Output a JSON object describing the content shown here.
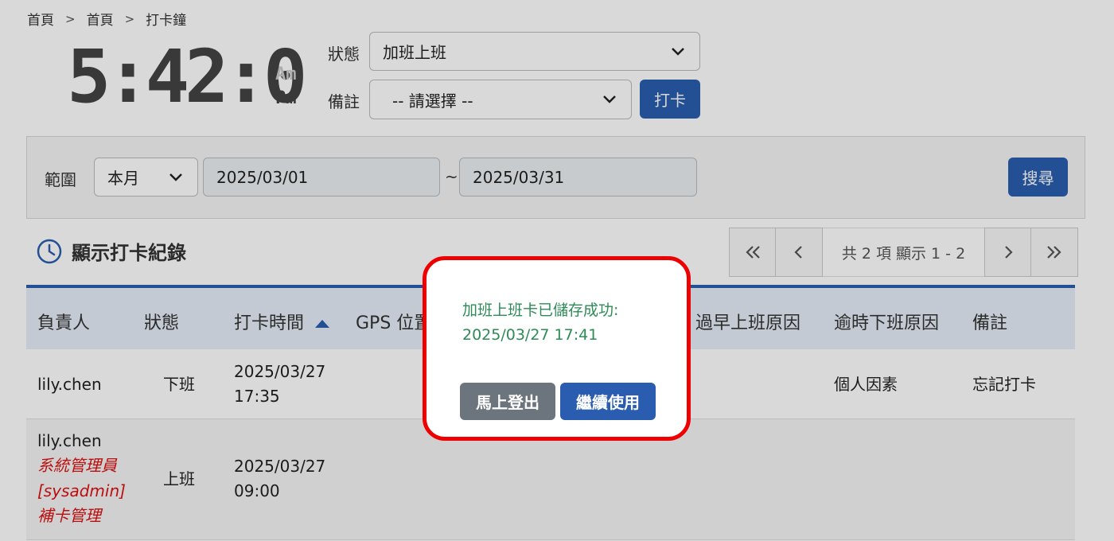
{
  "breadcrumb": {
    "items": [
      "首頁",
      "首頁",
      "打卡鐘"
    ],
    "separator": ">"
  },
  "clock": {
    "time": "5:42:00",
    "am": "Am",
    "pm": "Pm"
  },
  "punch_form": {
    "status_label": "狀態",
    "status_value": "加班上班",
    "remark_label": "備註",
    "remark_value": "-- 請選擇 --",
    "punch_button": "打卡"
  },
  "filter": {
    "range_label": "範圍",
    "range_value": "本月",
    "start_date": "2025/03/01",
    "tilde": "~",
    "end_date": "2025/03/31",
    "search_button": "搜尋"
  },
  "records": {
    "title": "顯示打卡紀錄",
    "pager_info": "共 2 項 顯示 1 - 2",
    "columns": [
      "負責人",
      "狀態",
      "打卡時間",
      "GPS 位置",
      "過早上班原因",
      "逾時下班原因",
      "備註"
    ],
    "rows": [
      {
        "owner": "lily.chen",
        "status": "下班",
        "time_date": "2025/03/27",
        "time_clock": "17:35",
        "late_reason": "個人因素",
        "remark": "忘記打卡"
      },
      {
        "owner": "lily.chen",
        "owner_note1": "系統管理員",
        "owner_note2": "[sysadmin]",
        "owner_note3": "補卡管理",
        "status": "上班",
        "time_date": "2025/03/27",
        "time_clock": "09:00"
      }
    ]
  },
  "dialog": {
    "message_line1": "加班上班卡已儲存成功:",
    "message_line2": "2025/03/27 17:41",
    "logout_button": "馬上登出",
    "continue_button": "繼續使用"
  },
  "colors": {
    "primary": "#2a5db0",
    "secondary": "#6c757d",
    "success_text": "#2e8b57",
    "highlight_border": "#e00000",
    "note_red": "#dd1111"
  }
}
